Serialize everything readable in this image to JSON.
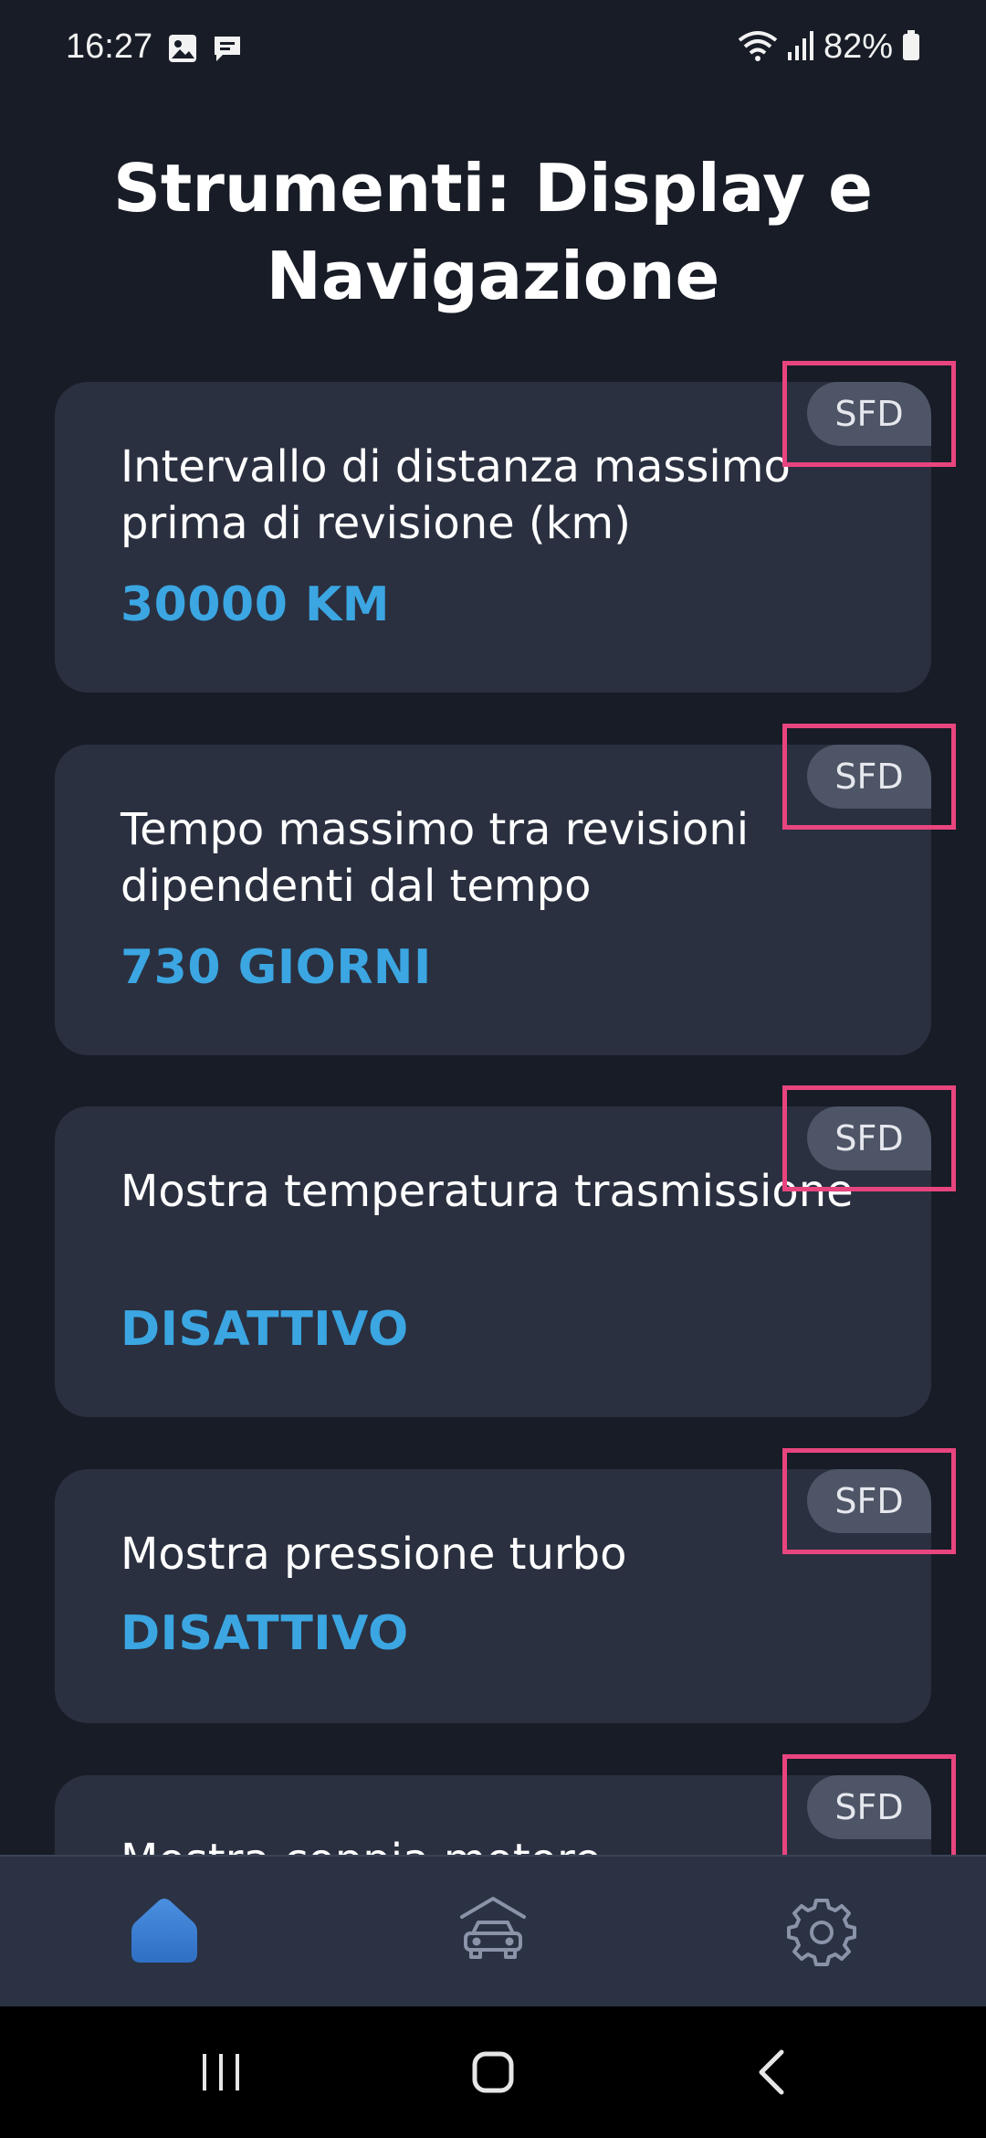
{
  "status_bar": {
    "time": "16:27",
    "battery": "82%"
  },
  "page": {
    "title": "Strumenti: Display e Navigazione"
  },
  "cards": [
    {
      "badge": "SFD",
      "label": "Intervallo di distanza massimo prima di revisione (km)",
      "value": "30000 KM"
    },
    {
      "badge": "SFD",
      "label": "Tempo massimo tra revisioni dipendenti dal tempo",
      "value": "730 GIORNI"
    },
    {
      "badge": "SFD",
      "label": "Mostra temperatura trasmissione",
      "value": "DISATTIVO"
    },
    {
      "badge": "SFD",
      "label": "Mostra pressione turbo",
      "value": "DISATTIVO"
    },
    {
      "badge": "SFD",
      "label": "Mostra coppia motore",
      "value": ""
    }
  ],
  "bottom_nav": {
    "items": [
      {
        "icon": "home-icon",
        "active": true
      },
      {
        "icon": "car-garage-icon",
        "active": false
      },
      {
        "icon": "gear-icon",
        "active": false
      }
    ]
  },
  "colors": {
    "background": "#171c26",
    "card": "#2a3040",
    "accent": "#3ba6e2",
    "badge": "#4d5566",
    "highlight": "#e8457f"
  }
}
